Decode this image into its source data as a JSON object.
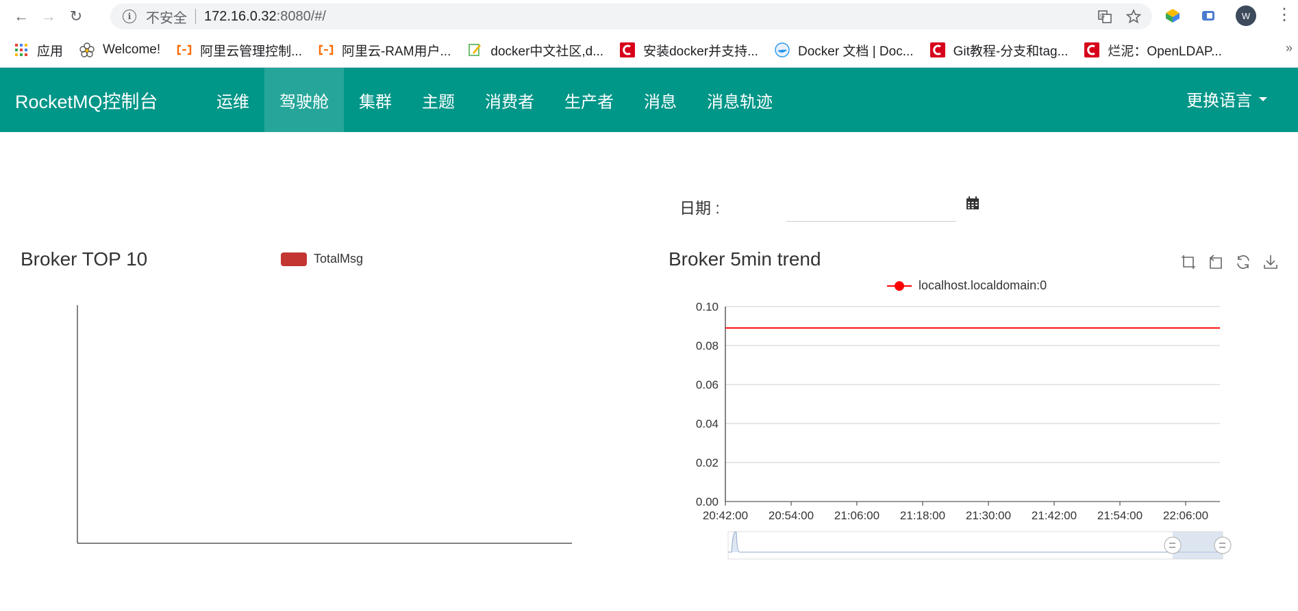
{
  "browser": {
    "url_insecure": "不安全",
    "url_host": "172.16.0.32",
    "url_rest": ":8080/#/",
    "avatar_letter": "W"
  },
  "bookmarks": [
    {
      "label": "应用",
      "icon": "apps-grid-icon"
    },
    {
      "label": "Welcome!",
      "icon": "flower-icon"
    },
    {
      "label": "阿里云管理控制...",
      "icon": "aliyun-icon"
    },
    {
      "label": "阿里云-RAM用户...",
      "icon": "aliyun-icon"
    },
    {
      "label": "docker中文社区,d...",
      "icon": "edit-note-icon"
    },
    {
      "label": "安装docker并支持...",
      "icon": "csdn-icon"
    },
    {
      "label": "Docker 文档 | Doc...",
      "icon": "docker-icon"
    },
    {
      "label": "Git教程-分支和tag...",
      "icon": "csdn-icon"
    },
    {
      "label": "烂泥：OpenLDAP...",
      "icon": "csdn-icon"
    }
  ],
  "navbar": {
    "brand": "RocketMQ控制台",
    "items": [
      "运维",
      "驾驶舱",
      "集群",
      "主题",
      "消费者",
      "生产者",
      "消息",
      "消息轨迹"
    ],
    "active_index": 1,
    "language": "更换语言"
  },
  "date_filter": {
    "label": "日期 :",
    "value": ""
  },
  "charts": {
    "left": {
      "title": "Broker TOP 10",
      "legend": "TotalMsg"
    },
    "right": {
      "title": "Broker 5min trend",
      "legend": "localhost.localdomain:0"
    }
  },
  "colors": {
    "navbar": "#009688",
    "navbar_active": "#26a69a",
    "series_red": "#c23531",
    "trend_red": "#ff0000"
  },
  "chart_data": [
    {
      "type": "bar",
      "title": "Broker TOP 10",
      "series": [
        {
          "name": "TotalMsg",
          "values": []
        }
      ],
      "categories": []
    },
    {
      "type": "line",
      "title": "Broker 5min trend",
      "x": [
        "20:42:00",
        "20:54:00",
        "21:06:00",
        "21:18:00",
        "21:30:00",
        "21:42:00",
        "21:54:00",
        "22:06:00",
        "22:12:00"
      ],
      "x_ticks": [
        "20:42:00",
        "20:54:00",
        "21:06:00",
        "21:18:00",
        "21:30:00",
        "21:42:00",
        "21:54:00",
        "22:06:00"
      ],
      "series": [
        {
          "name": "localhost.localdomain:0",
          "values": [
            0.089,
            0.089,
            0.089,
            0.089,
            0.089,
            0.089,
            0.089,
            0.089,
            0.089
          ]
        }
      ],
      "y_ticks": [
        "0.00",
        "0.02",
        "0.04",
        "0.06",
        "0.08",
        "0.10"
      ],
      "ylim": [
        0,
        0.1
      ],
      "grid": true,
      "legend_position": "top-center"
    }
  ]
}
